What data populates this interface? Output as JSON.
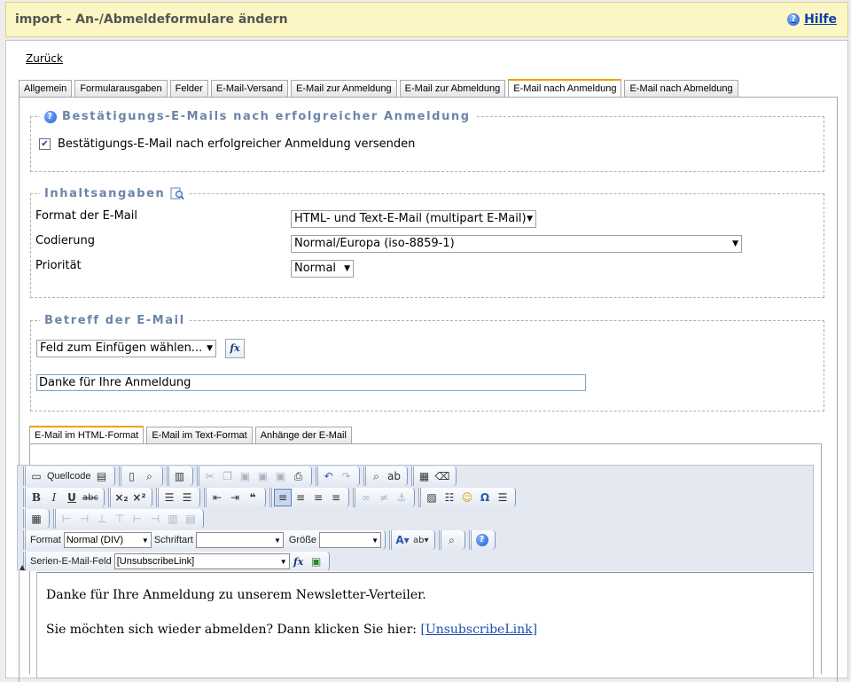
{
  "header": {
    "title": "import - An-/Abmeldeformulare ändern",
    "help_label": "Hilfe",
    "help_icon": "question-icon"
  },
  "back_link": "Zurück",
  "main_tabs": [
    {
      "label": "Allgemein",
      "active": false
    },
    {
      "label": "Formularausgaben",
      "active": false
    },
    {
      "label": "Felder",
      "active": false
    },
    {
      "label": "E-Mail-Versand",
      "active": false
    },
    {
      "label": "E-Mail zur Anmeldung",
      "active": false
    },
    {
      "label": "E-Mail zur Abmeldung",
      "active": false
    },
    {
      "label": "E-Mail nach Anmeldung",
      "active": true
    },
    {
      "label": "E-Mail nach Abmeldung",
      "active": false
    }
  ],
  "confirm_section": {
    "legend": "Bestätigungs-E-Mails nach erfolgreicher Anmeldung",
    "checkbox_label": "Bestätigungs-E-Mail nach erfolgreicher Anmeldung versenden",
    "checked": true
  },
  "content_section": {
    "legend": "Inhaltsangaben",
    "format_label": "Format der E-Mail",
    "format_value": "HTML- und Text-E-Mail (multipart E-Mail)",
    "encoding_label": "Codierung",
    "encoding_value": "Normal/Europa (iso-8859-1)",
    "priority_label": "Priorität",
    "priority_value": "Normal"
  },
  "subject_section": {
    "legend": "Betreff der E-Mail",
    "insert_field_value": "Feld zum Einfügen wählen...",
    "fx_label": "fx",
    "subject_value": "Danke für Ihre Anmeldung"
  },
  "editor_tabs": [
    {
      "label": "E-Mail im HTML-Format",
      "active": true
    },
    {
      "label": "E-Mail im Text-Format",
      "active": false
    },
    {
      "label": "Anhänge der E-Mail",
      "active": false
    }
  ],
  "toolbar": {
    "source_label": "Quellcode",
    "format_label": "Format",
    "format_value": "Normal (DIV)",
    "font_label": "Schriftart",
    "font_value": "",
    "size_label": "Größe",
    "size_value": "",
    "merge_field_label": "Serien-E-Mail-Feld",
    "merge_field_value": "[UnsubscribeLink]",
    "fx_label": "fx"
  },
  "editor_content": {
    "line1": "Danke für Ihre Anmeldung zu unserem Newsletter-Verteiler.",
    "line2_text": "Sie möchten sich wieder abmelden? Dann klicken Sie hier: ",
    "line2_link": "[UnsubscribeLink]"
  }
}
